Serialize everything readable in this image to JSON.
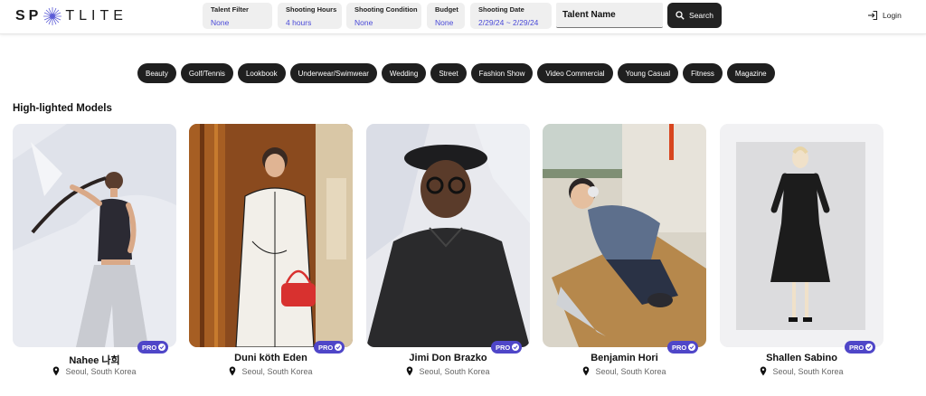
{
  "brand": {
    "logo_left": "SP",
    "logo_right": "TLITE"
  },
  "filters": [
    {
      "label": "Talent Filter",
      "value": "None"
    },
    {
      "label": "Shooting Hours",
      "value": "4 hours"
    },
    {
      "label": "Shooting Condition",
      "value": "None"
    },
    {
      "label": "Budget",
      "value": "None"
    },
    {
      "label": "Shooting Date",
      "value": "2/29/24 ~ 2/29/24"
    }
  ],
  "search": {
    "placeholder": "Talent Name",
    "button_label": "Search"
  },
  "header": {
    "login_label": "Login"
  },
  "categories": [
    "Beauty",
    "Golf/Tennis",
    "Lookbook",
    "Underwear/Swimwear",
    "Wedding",
    "Street",
    "Fashion Show",
    "Video Commercial",
    "Young Casual",
    "Fitness",
    "Magazine"
  ],
  "section": {
    "title": "High-lighted Models"
  },
  "badge": {
    "pro_label": "PRO"
  },
  "models": [
    {
      "name": "Nahee 나희",
      "location": "Seoul, South Korea"
    },
    {
      "name": "Duni köth Eden",
      "location": "Seoul, South Korea"
    },
    {
      "name": "Jimi Don Brazko",
      "location": "Seoul, South Korea"
    },
    {
      "name": "Benjamin Hori",
      "location": "Seoul, South Korea"
    },
    {
      "name": "Shallen Sabino",
      "location": "Seoul, South Korea"
    }
  ],
  "icons": {
    "logo": "spotlight-star-icon",
    "search": "search-icon",
    "login": "login-icon",
    "pro_check": "check-icon",
    "location": "location-pin-icon"
  },
  "colors": {
    "accent": "#4a4ad8",
    "chip_bg": "#1f1f1f",
    "pro_badge": "#4f46c8",
    "button_bg": "#222222"
  }
}
